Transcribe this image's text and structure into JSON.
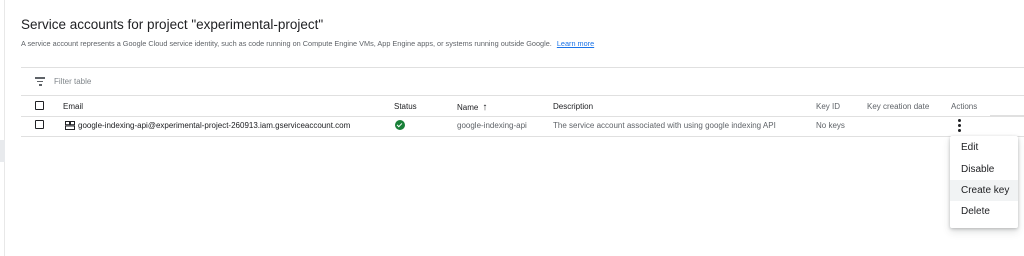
{
  "page": {
    "title": "Service accounts for project \"experimental-project\"",
    "description": "A service account represents a Google Cloud service identity, such as code running on Compute Engine VMs, App Engine apps, or systems running outside Google.",
    "learn_more": "Learn more"
  },
  "filter": {
    "icon": "filter-icon",
    "placeholder": "Filter table"
  },
  "table": {
    "columns": {
      "email": "Email",
      "status": "Status",
      "name": "Name",
      "name_sort": "↑",
      "description": "Description",
      "key_id": "Key ID",
      "key_creation_date": "Key creation date",
      "actions": "Actions"
    },
    "rows": [
      {
        "email": "google-indexing-api@experimental-project-260913.iam.gserviceaccount.com",
        "status": "enabled",
        "name": "google-indexing-api",
        "description": "The service account associated with using google indexing API",
        "key_id": "No keys",
        "key_creation_date": ""
      }
    ]
  },
  "actions_menu": {
    "items": [
      "Edit",
      "Disable",
      "Create key",
      "Delete"
    ],
    "hovered": "Create key"
  },
  "colors": {
    "accent": "#1a73e8",
    "status_ok": "#188038",
    "text": "#202124",
    "muted": "#5f6368"
  }
}
